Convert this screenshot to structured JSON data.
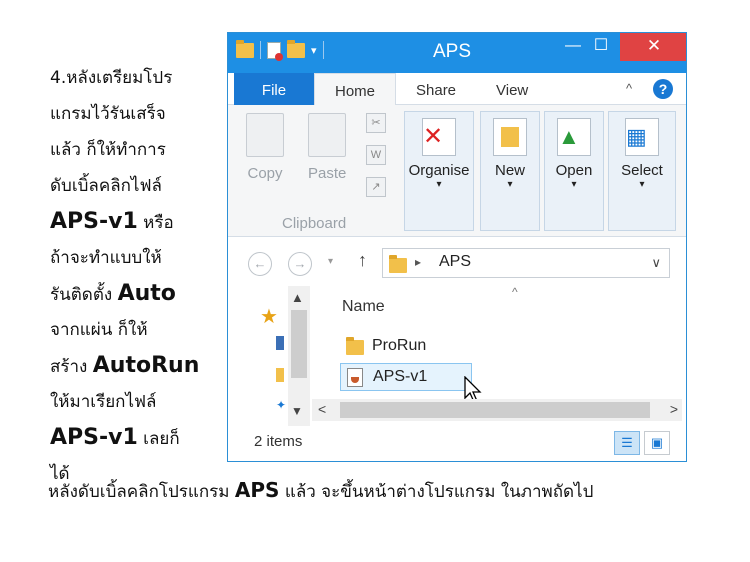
{
  "instructions": {
    "lines": [
      [
        {
          "t": "4.หลังเตรียมโปร"
        }
      ],
      [
        {
          "t": "แกรมไว้รันเสร็จ"
        }
      ],
      [
        {
          "t": "แล้ว ก็ให้ทำการ"
        }
      ],
      [
        {
          "t": "ดับเบิ้ลคลิกไฟล์"
        }
      ],
      [
        {
          "t": "APS-v1",
          "b": true
        },
        {
          "t": " หรือ"
        }
      ],
      [
        {
          "t": "ถ้าจะทำแบบให้"
        }
      ],
      [
        {
          "t": "รันติดตั้ง "
        },
        {
          "t": "Auto",
          "b": true
        }
      ],
      [
        {
          "t": "จากแผ่น   ก็ให้"
        }
      ],
      [
        {
          "t": "สร้าง "
        },
        {
          "t": "AutoRun",
          "b": true
        }
      ],
      [
        {
          "t": "ให้มาเรียกไฟล์"
        }
      ],
      [
        {
          "t": "APS-v1",
          "b": true
        },
        {
          "t": " เลยก็"
        }
      ],
      [
        {
          "t": "ได้"
        }
      ]
    ]
  },
  "caption": {
    "before": "หลังดับเบิ้ลคลิกโปรแกรม ",
    "bold": "APS",
    "after": " แล้ว จะขึ้นหน้าต่างโปรแกรม ในภาพถัดไป"
  },
  "window": {
    "title": "APS",
    "minimize_glyph": "—",
    "maximize_glyph": "☐",
    "close_glyph": "✕"
  },
  "tabs": {
    "file": "File",
    "home": "Home",
    "share": "Share",
    "view": "View",
    "collapse": "^",
    "help": "?"
  },
  "ribbon": {
    "copy": "Copy",
    "paste": "Paste",
    "clipboard_group": "Clipboard",
    "organise": "Organise",
    "new": "New",
    "open": "Open",
    "select": "Select",
    "dropdown": "▾"
  },
  "address": {
    "back": "←",
    "forward": "→",
    "up": "↑",
    "separator": "▸",
    "path": "APS",
    "dropdown": "∨"
  },
  "file_list": {
    "column_name": "Name",
    "items": [
      {
        "name": "ProRun",
        "type": "folder"
      },
      {
        "name": "APS-v1",
        "type": "jar",
        "selected": true
      }
    ]
  },
  "status": {
    "item_count": "2 items"
  },
  "colors": {
    "titlebar": "#1e8fe4",
    "file_tab": "#1978d3",
    "close": "#e04343",
    "selection": "#e5f3fd"
  }
}
